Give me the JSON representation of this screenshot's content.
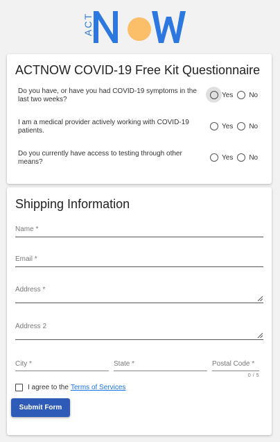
{
  "brand": {
    "logo_act": "ACT",
    "logo_now": "NOW",
    "blue": "#2c78e0",
    "dot": "#fbbf6a"
  },
  "questionnaire": {
    "title": "ACTNOW COVID-19 Free Kit Questionnaire",
    "questions": [
      {
        "text": "Do you have, or have you had COVID-19 symptoms in the last two weeks?",
        "yes": "Yes",
        "no": "No"
      },
      {
        "text": "I am a medical provider actively working with COVID-19 patients.",
        "yes": "Yes",
        "no": "No"
      },
      {
        "text": "Do you currently have access to testing through other means?",
        "yes": "Yes",
        "no": "No"
      }
    ]
  },
  "shipping": {
    "title": "Shipping Information",
    "fields": {
      "name": "Name *",
      "email": "Email *",
      "address": "Address *",
      "address2": "Address 2",
      "city": "City *",
      "state": "State *",
      "postal": "Postal Code *",
      "postal_counter": "0 / 5"
    },
    "agree_text": "I agree to the",
    "terms_link": "Terms of Services",
    "submit": "Submit Form"
  },
  "colors": {
    "button": "#2f5bb8",
    "link": "#1a73e8"
  }
}
